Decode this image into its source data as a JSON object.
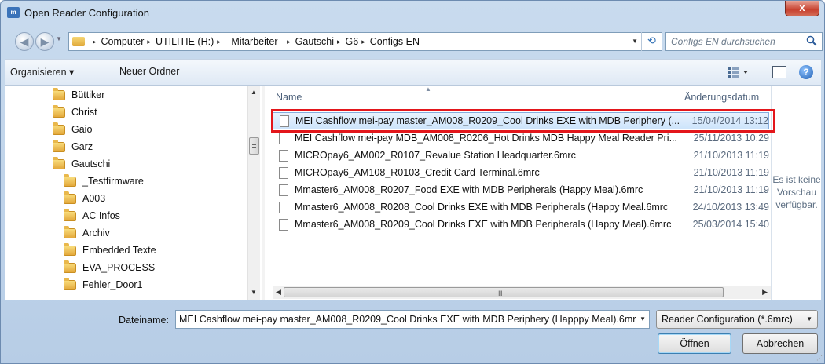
{
  "window": {
    "title": "Open Reader Configuration",
    "close_glyph": "x"
  },
  "address_bar": {
    "crumbs": [
      "Computer",
      "UTILITIE (H:)",
      "- Mitarbeiter -",
      "Gautschi",
      "G6",
      "Configs EN"
    ],
    "separator": "▸",
    "refresh_glyph": "⟲"
  },
  "search": {
    "placeholder": "Configs EN durchsuchen"
  },
  "toolbar": {
    "organize_label": "Organisieren ▾",
    "new_folder_label": "Neuer Ordner",
    "help_glyph": "?"
  },
  "navigation": {
    "items": [
      "Büttiker",
      "Christ",
      "Gaio",
      "Garz",
      "Gautschi",
      "_Testfirmware",
      "A003",
      "AC Infos",
      "Archiv",
      "Embedded Texte",
      "EVA_PROCESS",
      "Fehler_Door1"
    ]
  },
  "file_list": {
    "columns": {
      "name": "Name",
      "date": "Änderungsdatum"
    },
    "selected_index": 0,
    "rows": [
      {
        "name": "MEI Cashflow mei-pay master_AM008_R0209_Cool Drinks EXE with MDB Periphery (...",
        "date": "15/04/2014 13:12"
      },
      {
        "name": "MEI Cashflow mei-pay MDB_AM008_R0206_Hot Drinks MDB Happy Meal Reader Pri...",
        "date": "25/11/2013 10:29"
      },
      {
        "name": "MICROpay6_AM002_R0107_Revalue Station Headquarter.6mrc",
        "date": "21/10/2013 11:19"
      },
      {
        "name": "MICROpay6_AM108_R0103_Credit Card Terminal.6mrc",
        "date": "21/10/2013 11:19"
      },
      {
        "name": "Mmaster6_AM008_R0207_Food EXE with MDB Peripherals (Happy Meal).6mrc",
        "date": "21/10/2013 11:19"
      },
      {
        "name": "Mmaster6_AM008_R0208_Cool Drinks EXE with MDB Peripherals (Happy Meal.6mrc",
        "date": "24/10/2013 13:49"
      },
      {
        "name": "Mmaster6_AM008_R0209_Cool Drinks EXE with MDB Peripherals (Happy Meal).6mrc",
        "date": "25/03/2014 15:40"
      }
    ]
  },
  "preview": {
    "line1": "Es ist keine",
    "line2": "Vorschau",
    "line3": "verfügbar."
  },
  "footer": {
    "filename_label": "Dateiname:",
    "filename_value": "MEI Cashflow mei-pay master_AM008_R0209_Cool Drinks EXE with MDB Periphery (Happpy Meal).6mr",
    "filter_value": "Reader Configuration (*.6mrc)",
    "open_label": "Öffnen",
    "cancel_label": "Abbrechen"
  },
  "colors": {
    "highlight": "#e3161b",
    "selection": "#cde4fb"
  }
}
